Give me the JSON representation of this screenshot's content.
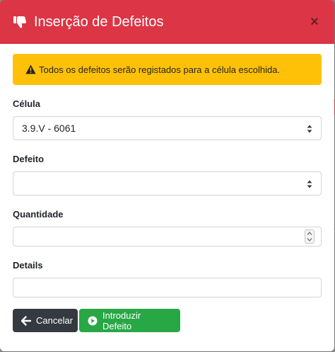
{
  "modal": {
    "title": "Inserção de Defeitos",
    "header_color": "#dc3545",
    "header_icon": "thumbs-down-icon",
    "close_label": "×"
  },
  "alert": {
    "icon": "warning-triangle-icon",
    "text": "Todos os defeitos serão registados para a célula escolhida.",
    "color": "#ffc107"
  },
  "form": {
    "cell": {
      "label": "Célula",
      "value": "3.9.V - 6061"
    },
    "defect": {
      "label": "Defeito",
      "value": ""
    },
    "quantity": {
      "label": "Quantidade",
      "value": ""
    },
    "details": {
      "label": "Details",
      "value": ""
    }
  },
  "actions": {
    "cancel": {
      "label": "Cancelar",
      "icon": "arrow-left-icon",
      "color": "#343a40"
    },
    "submit": {
      "label": "Introduzir Defeito",
      "icon": "play-circle-icon",
      "color": "#28a745"
    }
  }
}
